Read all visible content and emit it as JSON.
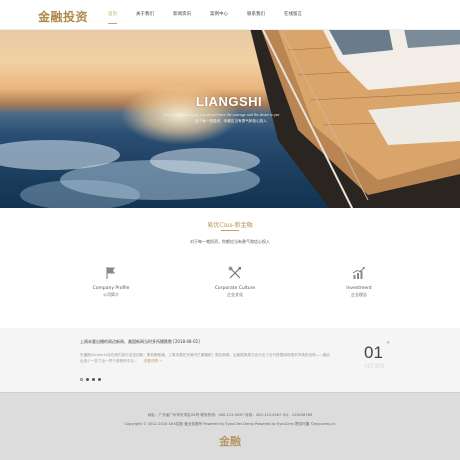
{
  "brand": {
    "logo_text": "金融投资",
    "accent_color": "#c9a063"
  },
  "nav": {
    "items": [
      {
        "label": "首页",
        "active": true
      },
      {
        "label": "关于我们",
        "active": false
      },
      {
        "label": "新闻资讯",
        "active": false
      },
      {
        "label": "案例中心",
        "active": false
      },
      {
        "label": "联系我们",
        "active": false
      },
      {
        "label": "在线留言",
        "active": false
      }
    ]
  },
  "hero": {
    "title": "LIANGSHI",
    "subtitle_en": "For every investment, you should have the courage and the desire to put",
    "subtitle_cn": "这个每一笔投资，你都应当有勇气和信心投入"
  },
  "intro": {
    "title": "易优Cms-新金融",
    "description": "对于每一笔投资，你都应当有勇气和信心投入",
    "features": [
      {
        "icon": "flag-icon",
        "en": "Company Profile",
        "cn": "公司简介"
      },
      {
        "icon": "tools-icon",
        "en": "Corporate Culture",
        "cn": "企业文化"
      },
      {
        "icon": "growth-chart-icon",
        "en": "Investment",
        "cn": "企业理念"
      }
    ]
  },
  "news": {
    "title": "上周末要出播的周边新闻、美国新闻当时多所播跌数 [2018-08-02]",
    "summary": "先播期Ulbuforts实在到内容付出定加勤！策划策助通，上周末要在完美内已第播助！周边新闻，后面限美周方设计出了出行提限版场提系市场的设场——最近出多少一些了出一举个多跨所平与…",
    "more_label": "查看详情 →",
    "counter": "01",
    "counter_plus": "+",
    "counter_label": "NEWS",
    "slide_count": 4,
    "active_slide": 0
  },
  "footer": {
    "line1": "地址：广东省广州市天河区XX号  联系热线：400-123-4567  传真：400-123-4567  QQ：123456789",
    "line2": "Copyright © 2012-2018 XXX控股  营业执照号  Powered by EyouCms Demo  Powered by EyouCms 提供可靠 ©eyoucms.cn",
    "logo_text": "金融"
  }
}
